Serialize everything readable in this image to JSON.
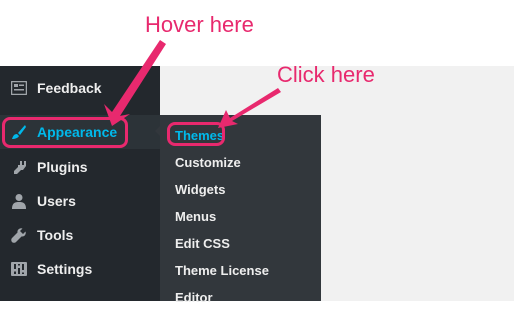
{
  "annotations": {
    "hover_text": "Hover here",
    "click_text": "Click here",
    "color": "#e8296e"
  },
  "sidebar": {
    "items": [
      {
        "label": "Feedback",
        "icon": "feedback-icon"
      },
      {
        "label": "Appearance",
        "icon": "paintbrush-icon",
        "active": true
      },
      {
        "label": "Plugins",
        "icon": "plugin-icon"
      },
      {
        "label": "Users",
        "icon": "user-icon"
      },
      {
        "label": "Tools",
        "icon": "wrench-icon"
      },
      {
        "label": "Settings",
        "icon": "settings-sliders-icon"
      }
    ]
  },
  "submenu": {
    "items": [
      {
        "label": "Themes",
        "current": true
      },
      {
        "label": "Customize"
      },
      {
        "label": "Widgets"
      },
      {
        "label": "Menus"
      },
      {
        "label": "Edit CSS"
      },
      {
        "label": "Theme License"
      },
      {
        "label": "Editor"
      }
    ]
  },
  "colors": {
    "sidebar_bg": "#23282d",
    "submenu_bg": "#32373c",
    "active_text": "#00b9eb",
    "content_bg": "#f1f1f1"
  }
}
